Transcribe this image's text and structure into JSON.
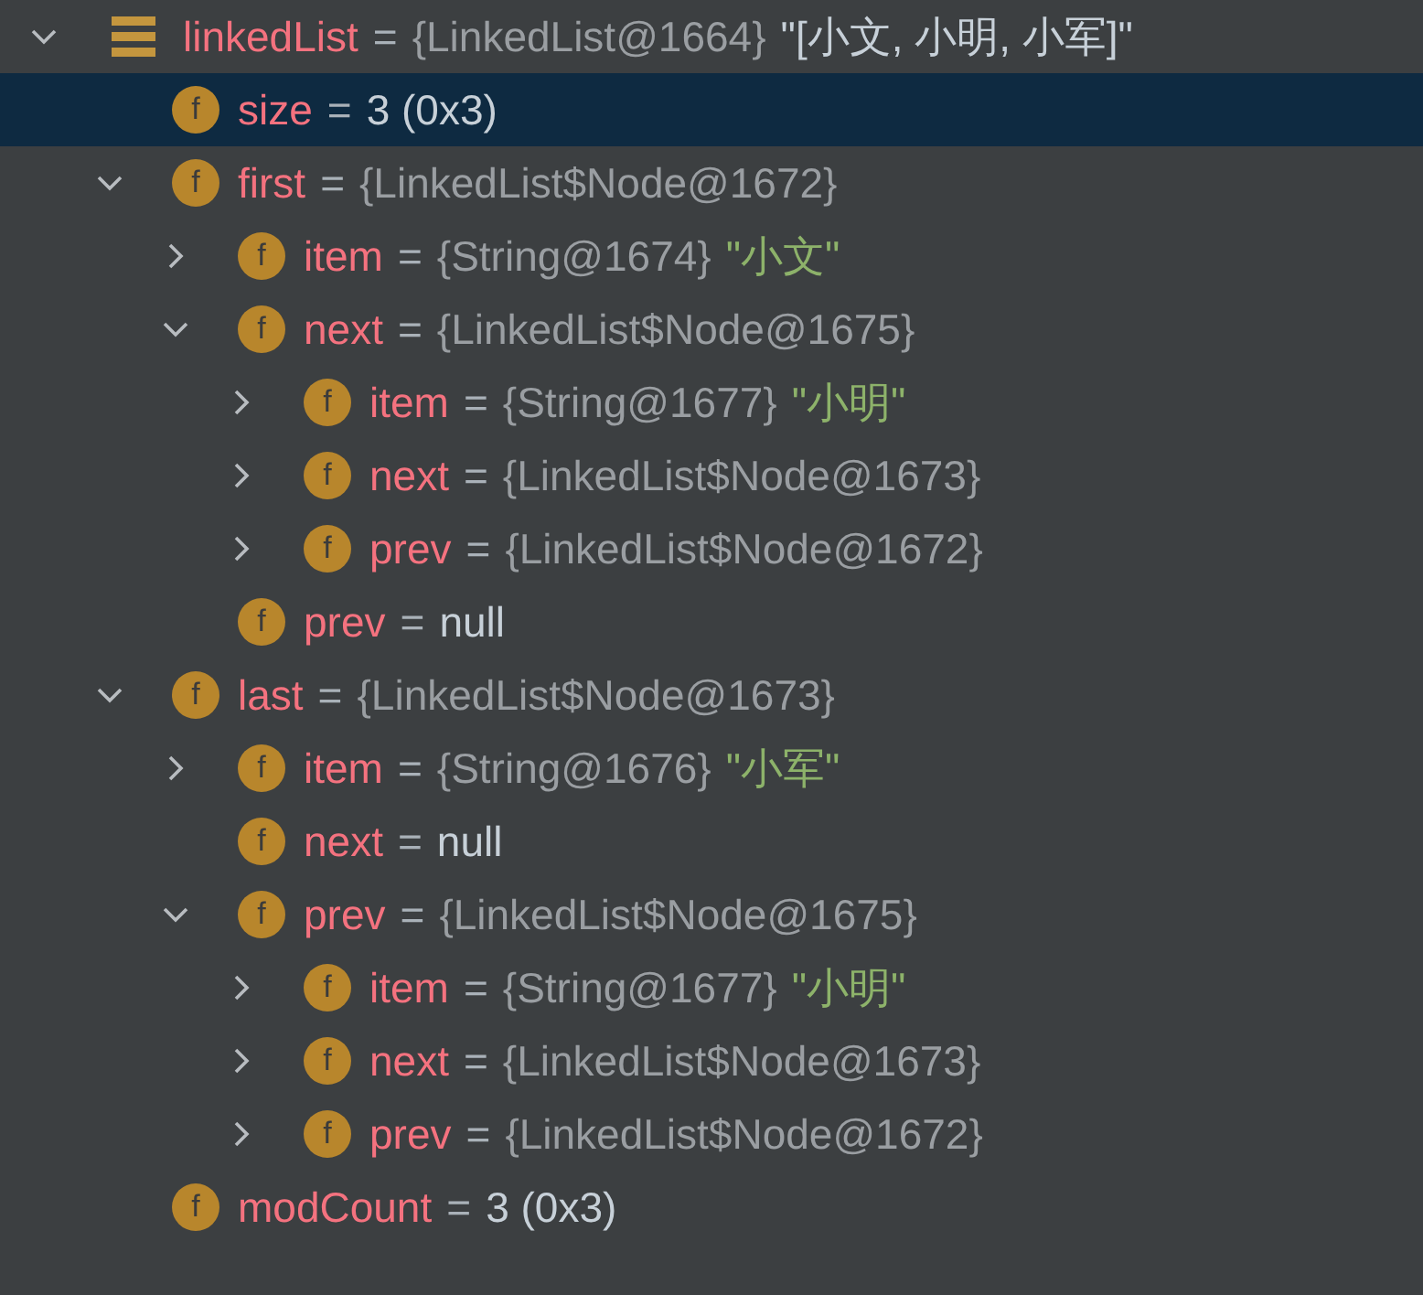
{
  "tree": [
    {
      "kind": "list",
      "name": "linkedList",
      "sep": "=",
      "ref": "{LinkedList@1664}",
      "value": "\"[小文, 小明, 小军]\"",
      "color": "#c7d0d8",
      "expanded": true,
      "selected": false,
      "children": [
        {
          "kind": "field",
          "icon": "f",
          "name": "size",
          "sep": "=",
          "value": "3 (0x3)",
          "color": "#c7d0d8",
          "selected": true
        },
        {
          "kind": "field",
          "icon": "f",
          "name": "first",
          "sep": "=",
          "ref": "{LinkedList$Node@1672}",
          "expanded": true,
          "selected": false,
          "children": [
            {
              "kind": "field",
              "icon": "f",
              "name": "item",
              "sep": "=",
              "ref": "{String@1674}",
              "value": "\"小文\"",
              "color": "#8db26a",
              "expanded": false,
              "selected": false
            },
            {
              "kind": "field",
              "icon": "f",
              "name": "next",
              "sep": "=",
              "ref": "{LinkedList$Node@1675}",
              "expanded": true,
              "selected": false,
              "children": [
                {
                  "kind": "field",
                  "icon": "f",
                  "name": "item",
                  "sep": "=",
                  "ref": "{String@1677}",
                  "value": "\"小明\"",
                  "color": "#8db26a",
                  "expanded": false,
                  "selected": false
                },
                {
                  "kind": "field",
                  "icon": "f",
                  "name": "next",
                  "sep": "=",
                  "ref": "{LinkedList$Node@1673}",
                  "expanded": false,
                  "selected": false
                },
                {
                  "kind": "field",
                  "icon": "f",
                  "name": "prev",
                  "sep": "=",
                  "ref": "{LinkedList$Node@1672}",
                  "expanded": false,
                  "selected": false
                }
              ]
            },
            {
              "kind": "field",
              "icon": "f",
              "name": "prev",
              "sep": "=",
              "value": "null",
              "color": "#c7d0d8",
              "selected": false
            }
          ]
        },
        {
          "kind": "field",
          "icon": "f",
          "name": "last",
          "sep": "=",
          "ref": "{LinkedList$Node@1673}",
          "expanded": true,
          "selected": false,
          "children": [
            {
              "kind": "field",
              "icon": "f",
              "name": "item",
              "sep": "=",
              "ref": "{String@1676}",
              "value": "\"小军\"",
              "color": "#8db26a",
              "expanded": false,
              "selected": false
            },
            {
              "kind": "field",
              "icon": "f",
              "name": "next",
              "sep": "=",
              "value": "null",
              "color": "#c7d0d8",
              "selected": false
            },
            {
              "kind": "field",
              "icon": "f",
              "name": "prev",
              "sep": "=",
              "ref": "{LinkedList$Node@1675}",
              "expanded": true,
              "selected": false,
              "children": [
                {
                  "kind": "field",
                  "icon": "f",
                  "name": "item",
                  "sep": "=",
                  "ref": "{String@1677}",
                  "value": "\"小明\"",
                  "color": "#8db26a",
                  "expanded": false,
                  "selected": false
                },
                {
                  "kind": "field",
                  "icon": "f",
                  "name": "next",
                  "sep": "=",
                  "ref": "{LinkedList$Node@1673}",
                  "expanded": false,
                  "selected": false
                },
                {
                  "kind": "field",
                  "icon": "f",
                  "name": "prev",
                  "sep": "=",
                  "ref": "{LinkedList$Node@1672}",
                  "expanded": false,
                  "selected": false
                }
              ]
            }
          ]
        },
        {
          "kind": "field",
          "icon": "f",
          "name": "modCount",
          "sep": "=",
          "value": "3 (0x3)",
          "color": "#c7d0d8",
          "selected": false
        }
      ]
    }
  ]
}
